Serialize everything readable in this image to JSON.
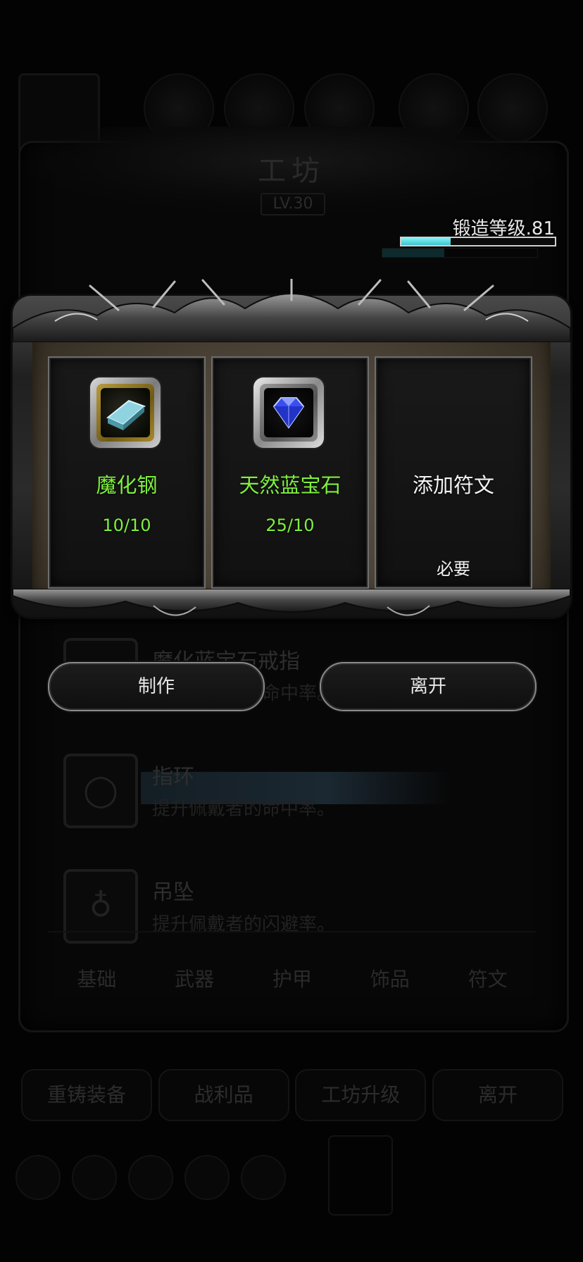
{
  "background": {
    "workshop_title": "工坊",
    "workshop_level": "LV.30",
    "list_items": [
      {
        "name": "魔化蓝宝石戒指",
        "desc": "提升佩戴者的命中率。",
        "icon": "ring-icon"
      },
      {
        "name": "指环",
        "desc": "提升佩戴者的命中率。",
        "icon": "ring-icon"
      },
      {
        "name": "吊坠",
        "desc": "提升佩戴者的闪避率。",
        "icon": "pendant-icon"
      }
    ],
    "tabs": [
      "基础",
      "武器",
      "护甲",
      "饰品",
      "符文"
    ],
    "bottom_buttons": [
      "重铸装备",
      "战利品",
      "工坊升级",
      "离开"
    ]
  },
  "forge": {
    "label": "锻造等级.81",
    "progress": 0.32,
    "bar_color": "#5fd8de"
  },
  "dialog": {
    "slots": [
      {
        "name": "魔化钢",
        "count": "10/10",
        "icon": "steel-ingot-icon",
        "color": "#7ef03e"
      },
      {
        "name": "天然蓝宝石",
        "count": "25/10",
        "icon": "blue-sapphire-icon",
        "color": "#7ef03e"
      },
      {
        "name": "添加符文",
        "required": "必要",
        "color": "#f4f4f4"
      }
    ],
    "craft_button": "制作",
    "leave_button": "离开"
  }
}
